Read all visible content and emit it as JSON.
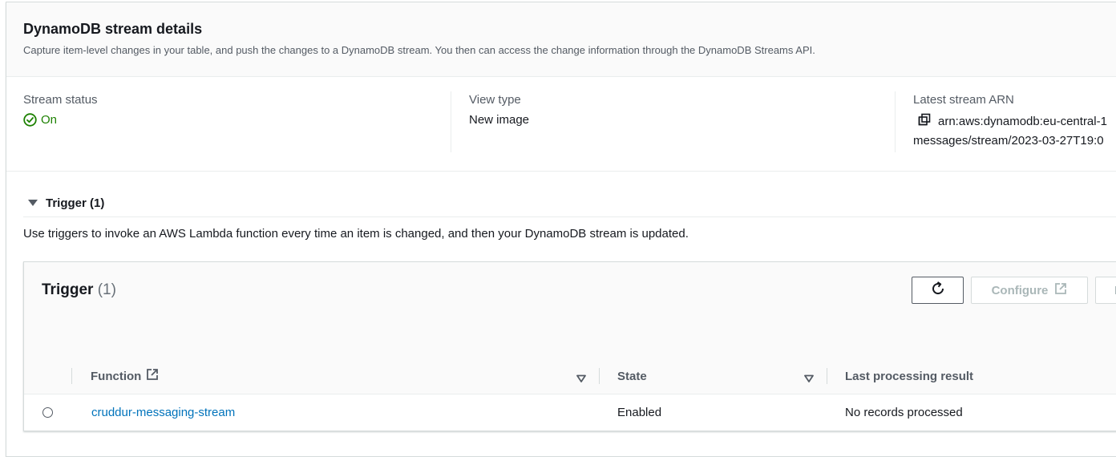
{
  "header": {
    "title": "DynamoDB stream details",
    "description": "Capture item-level changes in your table, and push the changes to a DynamoDB stream. You then can access the change information through the DynamoDB Streams API."
  },
  "details": {
    "stream_status_label": "Stream status",
    "stream_status_value": "On",
    "view_type_label": "View type",
    "view_type_value": "New image",
    "arn_label": "Latest stream ARN",
    "arn_line1": "arn:aws:dynamodb:eu-central-1",
    "arn_line2": "messages/stream/2023-03-27T19:0"
  },
  "trigger_section": {
    "expander_label": "Trigger (1)",
    "description": "Use triggers to invoke an AWS Lambda function every time an item is changed, and then your DynamoDB stream is updated."
  },
  "trigger_table": {
    "title": "Trigger",
    "count": "(1)",
    "buttons": {
      "configure_label": "Configure",
      "next_label": "I"
    },
    "columns": [
      "Function",
      "State",
      "Last processing result"
    ],
    "rows": [
      {
        "function": "cruddur-messaging-stream",
        "state": "Enabled",
        "last_result": "No records processed"
      }
    ]
  },
  "colors": {
    "status_on": "#1d8102",
    "link": "#0073bb",
    "disabled": "#aab7b8"
  },
  "icons": [
    "status-positive-icon",
    "copy-icon",
    "caret-down-icon",
    "refresh-icon",
    "external-link-icon",
    "sort-icon"
  ]
}
